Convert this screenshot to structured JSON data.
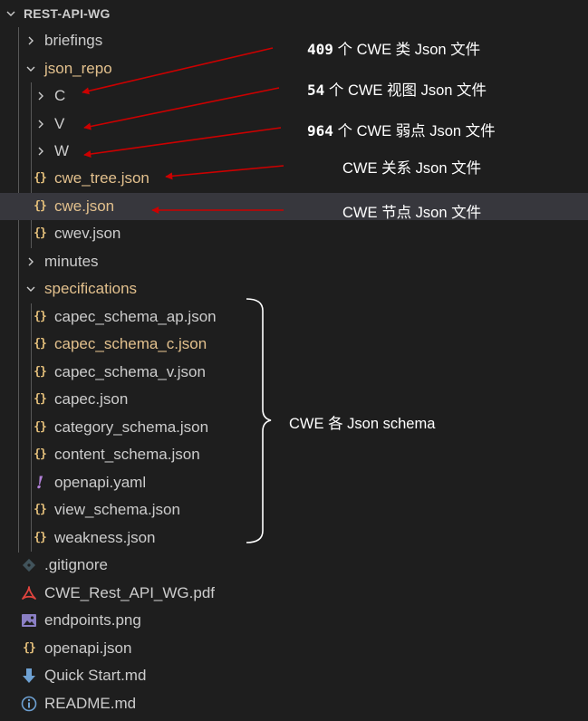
{
  "explorer": {
    "root": "REST-API-WG",
    "briefings": "briefings",
    "json_repo": "json_repo",
    "c": "C",
    "v": "V",
    "w": "W",
    "cwe_tree": "cwe_tree.json",
    "cwe": "cwe.json",
    "cwev": "cwev.json",
    "minutes": "minutes",
    "specifications": "specifications",
    "capec_schema_ap": "capec_schema_ap.json",
    "capec_schema_c": "capec_schema_c.json",
    "capec_schema_v": "capec_schema_v.json",
    "capec": "capec.json",
    "category_schema": "category_schema.json",
    "content_schema": "content_schema.json",
    "openapi_yaml": "openapi.yaml",
    "view_schema": "view_schema.json",
    "weakness": "weakness.json",
    "gitignore": ".gitignore",
    "pdf": "CWE_Rest_API_WG.pdf",
    "png": "endpoints.png",
    "openapi_json": "openapi.json",
    "quickstart": "Quick Start.md",
    "readme": "README.md"
  },
  "annotations": {
    "c": {
      "num": "409",
      "text": "个  CWE 类 Json 文件"
    },
    "v": {
      "num": "54",
      "text": "个  CWE 视图 Json 文件"
    },
    "w": {
      "num": "964",
      "text": "个  CWE 弱点 Json 文件"
    },
    "tree": "CWE 关系 Json 文件",
    "node": "CWE 节点 Json 文件",
    "schema": "CWE 各 Json schema"
  },
  "colors": {
    "background": "#1e1e1e",
    "selected_row": "#37373d",
    "json_icon": "#e5c07b",
    "modified_text": "#e2c08d",
    "arrow": "#cc0000"
  },
  "icons": {
    "chevron": "chevron-icon",
    "json": "json-braces-icon",
    "yaml": "exclamation-icon",
    "git": "git-diamond-icon",
    "pdf": "pdf-icon",
    "image": "image-icon",
    "markdown": "down-arrow-icon",
    "info": "info-icon"
  }
}
